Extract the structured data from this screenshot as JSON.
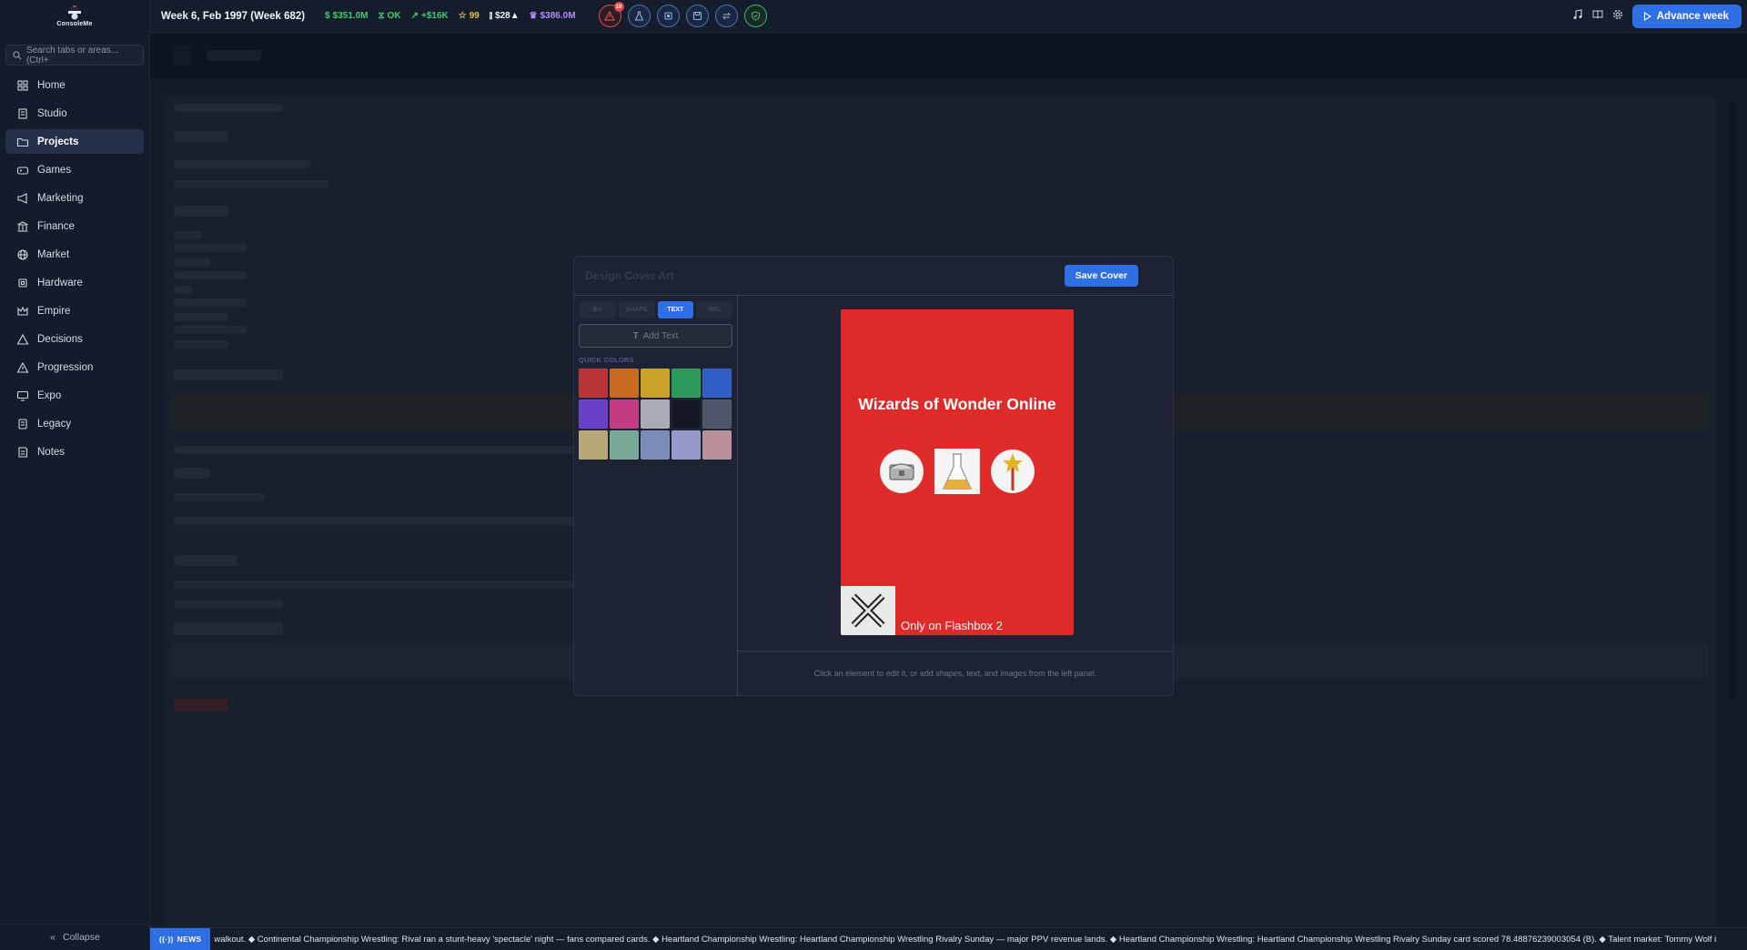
{
  "app": {
    "logo_text": "ConsoleMe"
  },
  "sidebar": {
    "search_placeholder": "Search tabs or areas... (Ctrl+",
    "items": [
      {
        "label": "Home",
        "icon": "home-icon"
      },
      {
        "label": "Studio",
        "icon": "building-icon"
      },
      {
        "label": "Projects",
        "icon": "folder-icon",
        "active": true
      },
      {
        "label": "Games",
        "icon": "gamepad-icon"
      },
      {
        "label": "Marketing",
        "icon": "megaphone-icon"
      },
      {
        "label": "Finance",
        "icon": "bank-icon"
      },
      {
        "label": "Market",
        "icon": "globe-icon"
      },
      {
        "label": "Hardware",
        "icon": "chip-icon"
      },
      {
        "label": "Empire",
        "icon": "crown-icon"
      },
      {
        "label": "Decisions",
        "icon": "warning-icon"
      },
      {
        "label": "Progression",
        "icon": "trend-icon"
      },
      {
        "label": "Expo",
        "icon": "monitor-icon"
      },
      {
        "label": "Legacy",
        "icon": "book-icon"
      },
      {
        "label": "Notes",
        "icon": "notes-icon"
      }
    ],
    "collapse_label": "Collapse"
  },
  "topbar": {
    "week": "Week 6, Feb 1997 (Week 682)",
    "stats": [
      {
        "value": "$351.0M",
        "icon": "dollar-icon",
        "color": "#3ecf6e"
      },
      {
        "value": "OK",
        "icon": "hourglass-icon",
        "color": "#3ecf6e"
      },
      {
        "value": "+$16K",
        "icon": "trend-up-icon",
        "color": "#3ecf6e"
      },
      {
        "value": "99",
        "icon": "star-icon",
        "color": "#e6c14a"
      },
      {
        "value": "$28▲",
        "icon": "bar-chart-icon",
        "color": "#f2f4f8"
      },
      {
        "value": "$386.0M",
        "icon": "crown-icon",
        "color": "#b08cf0"
      }
    ],
    "alert_count": "19",
    "advance_label": "Advance week"
  },
  "modal": {
    "title": "Design Cover Art",
    "save_label": "Save Cover",
    "tabs": [
      "BG",
      "SHAPE",
      "TEXT",
      "IMG"
    ],
    "active_tab": "TEXT",
    "add_text_label": "Add Text",
    "quick_colors_label": "QUICK COLORS",
    "quick_colors": [
      "#b8333a",
      "#c96a22",
      "#caa22a",
      "#2c9a5a",
      "#2f5fc4",
      "#6a3fc8",
      "#c23a82",
      "#a7acb5",
      "#141824",
      "#4c5569",
      "#b8a878",
      "#78a898",
      "#7c8cb8",
      "#9898c8",
      "#b8909a"
    ],
    "footer_hint": "Click an element to edit it, or add shapes, text, and images from the left panel.",
    "cover": {
      "background": "#df2a2a",
      "title": "Wizards of Wonder Online",
      "icons": [
        "treasure-chest-icon",
        "potion-flask-icon",
        "magic-wand-icon"
      ],
      "platform_text": "Only on Flashbox 2",
      "platform_logo": "x-logo-icon"
    }
  },
  "news": {
    "label": "NEWS",
    "text": "walkout. ◆ Continental Championship Wrestling: Rival ran a stunt-heavy 'spectacle' night — fans compared cards. ◆ Heartland Championship Wrestling: Heartland Championship Wrestling Rivalry Sunday — major PPV revenue lands. ◆ Heartland Championship Wrestling: Heartland Championship Wrestling Rivalry Sunday card scored 78.48876239003054 (B). ◆ Talent market: Tommy Wolf i"
  }
}
